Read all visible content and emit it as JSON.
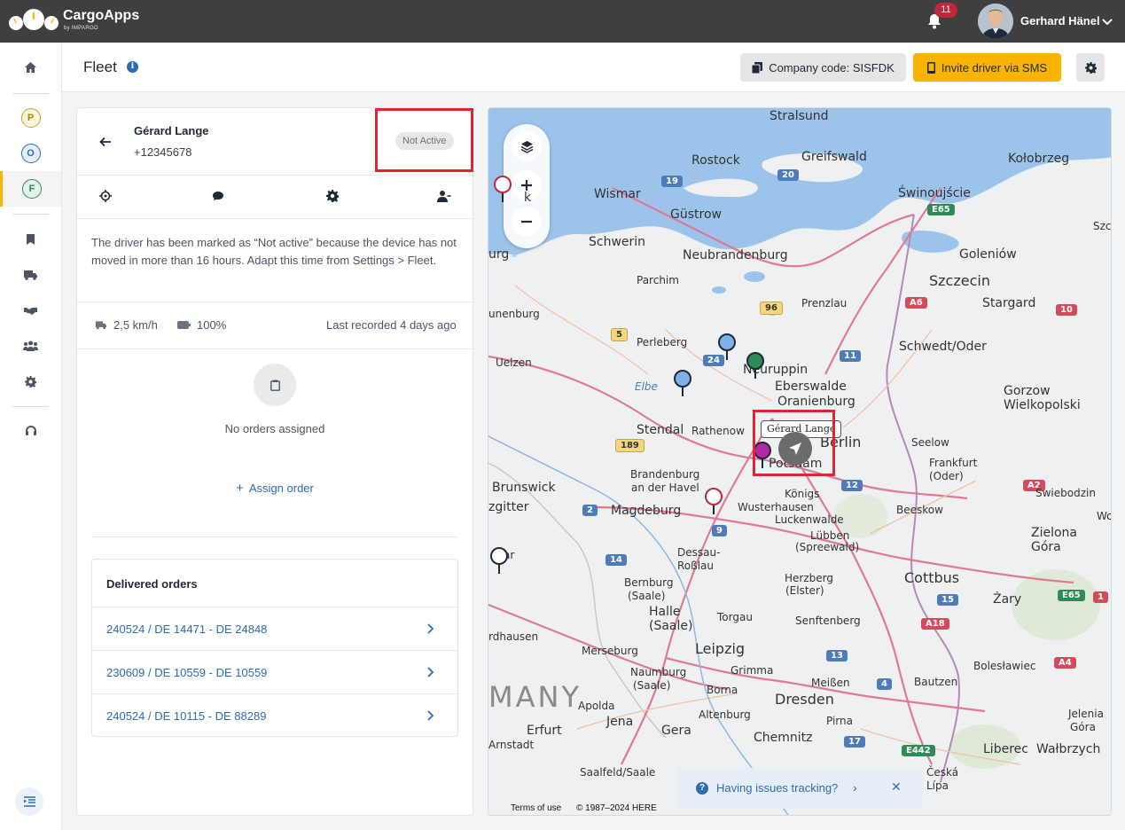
{
  "app": {
    "name": "CargoApps",
    "sub": "by IMPARGO"
  },
  "topbar": {
    "notification_count": "11",
    "user_name": "Gerhard Hänel"
  },
  "sidebar": {
    "items": [
      {
        "name": "home"
      },
      {
        "letter": "P",
        "color": "#c8a020"
      },
      {
        "letter": "O",
        "color": "#2c6cb3"
      },
      {
        "letter": "F",
        "color": "#2e8b57"
      }
    ]
  },
  "header": {
    "title": "Fleet",
    "company_code": "Company code: SISFDK",
    "invite": "Invite driver via SMS"
  },
  "driver": {
    "name": "Gérard Lange",
    "phone": "+12345678",
    "status": "Not Active",
    "notice": "The driver has been marked as “Not active” because the device has not moved in more than 16 hours. Adapt this time from Settings > Fleet.",
    "speed": "2,5 km/h",
    "battery": "100%",
    "last_recorded": "Last recorded 4 days ago",
    "no_orders": "No orders assigned",
    "assign": "Assign order"
  },
  "delivered": {
    "title": "Delivered orders",
    "orders": [
      "240524 / DE 14471 - DE 24848",
      "230609 / DE 10559 - DE 10559",
      "240524 / DE 10115 - DE 88289"
    ]
  },
  "map": {
    "cities": {
      "stralsund": "Stralsund",
      "rostock": "Rostock",
      "greifswald": "Greifswald",
      "kolobrzeg": "Kołobrzeg",
      "wismar": "Wismar",
      "swinoujscie": "Świnoujście",
      "gustrow": "Güstrow",
      "schwerin": "Schwerin",
      "neubrandenburg": "Neubrandenburg",
      "goleniow": "Goleniów",
      "szczecin": "Szczecin",
      "parchim": "Parchim",
      "prenzlau": "Prenzlau",
      "stargard": "Stargard",
      "perleberg": "Perleberg",
      "schwedt": "Schwedt/Oder",
      "uelzen": "Uelzen",
      "neuruppin": "Neuruppin",
      "eberswalde": "Eberswalde",
      "oranienburg": "Oranienburg",
      "elbe": "Elbe",
      "gorzow1": "Gorzow",
      "gorzow2": "Wielkopolski",
      "stendal": "Stendal",
      "rathenow": "Rathenow",
      "berlin": "Berlin",
      "seelow": "Seelow",
      "potsdam": "Potsdam",
      "brandenburg1": "Brandenburg",
      "brandenburg2": "an der Havel",
      "frankfurt1": "Frankfurt",
      "frankfurt2": "(Oder)",
      "brunswick": "Brunswick",
      "konigs": "Königs",
      "wusterhausen": "Wusterhausen",
      "swiebodzin": "Świebodzin",
      "magdeburg": "Magdeburg",
      "luckenwalde": "Luckenwalde",
      "beeskow": "Beeskow",
      "lubben1": "Lübben",
      "lubben2": "(Spreewald)",
      "dessau1": "Dessau-",
      "dessau2": "Roßlau",
      "zielona1": "Zielona",
      "zielona2": "Góra",
      "bernburg1": "Bernburg",
      "bernburg2": "(Saale)",
      "herzberg1": "Herzberg",
      "herzberg2": "(Elster)",
      "cottbus": "Cottbus",
      "halle1": "Halle",
      "halle2": "(Saale)",
      "torgau": "Torgau",
      "senftenberg": "Senftenberg",
      "zary": "Żary",
      "merseburg": "Merseburg",
      "leipzig": "Leipzig",
      "grimma": "Grimma",
      "boleslawiec": "Bolesławiec",
      "naumburg1": "Naumburg",
      "naumburg2": "(Saale)",
      "meissen": "Meißen",
      "bautzen": "Bautzen",
      "borna": "Borna",
      "apolda": "Apolda",
      "dresden": "Dresden",
      "jelenia1": "Jelenia",
      "jelenia2": "Góra",
      "altenburg": "Altenburg",
      "erfurt": "Erfurt",
      "jena": "Jena",
      "gera": "Gera",
      "pirna": "Pirna",
      "chemnitz": "Chemnitz",
      "liberec": "Liberec",
      "walbrzych": "Wałbrzych",
      "saalfeld": "Saalfeld/Saale",
      "ceska1": "Česká",
      "ceska2": "Lípa",
      "gottingen": "rdhausen",
      "arnstadt": "Arnstadt",
      "zgitter": "zgitter",
      "unenburg": "unenburg",
      "rg": "urg",
      "k": "k",
      "szc": "Szc",
      "wo": "Wo",
      "ar": "ar",
      "many": "MANY"
    },
    "tooltip": "Gérard Lange",
    "terms": "Terms of use",
    "copyright": "© 1987–2024 HERE",
    "issue": "Having issues tracking?"
  }
}
